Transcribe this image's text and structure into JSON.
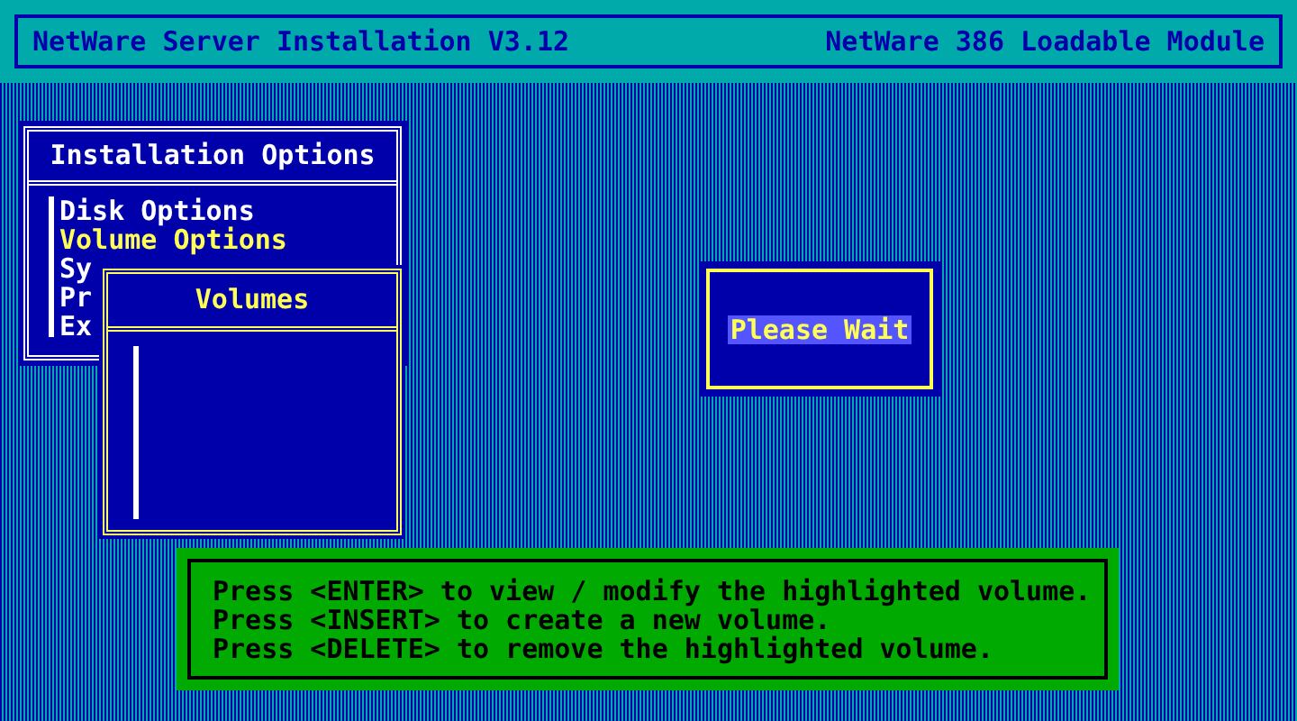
{
  "header": {
    "title": "NetWare Server Installation V3.12",
    "subtitle": "NetWare 386 Loadable Module"
  },
  "installation_options": {
    "title": "Installation Options",
    "items": [
      {
        "label": "Disk Options",
        "selected": false
      },
      {
        "label": "Volume Options",
        "selected": true
      },
      {
        "label": "Sy",
        "selected": false
      },
      {
        "label": "Pr",
        "selected": false
      },
      {
        "label": "Ex",
        "selected": false
      }
    ]
  },
  "volumes": {
    "title": "Volumes"
  },
  "status": {
    "message": "Please Wait"
  },
  "help": {
    "lines": [
      "Press <ENTER> to view / modify the highlighted volume.",
      "Press <INSERT> to create a new volume.",
      "Press <DELETE> to remove the highlighted volume."
    ]
  }
}
